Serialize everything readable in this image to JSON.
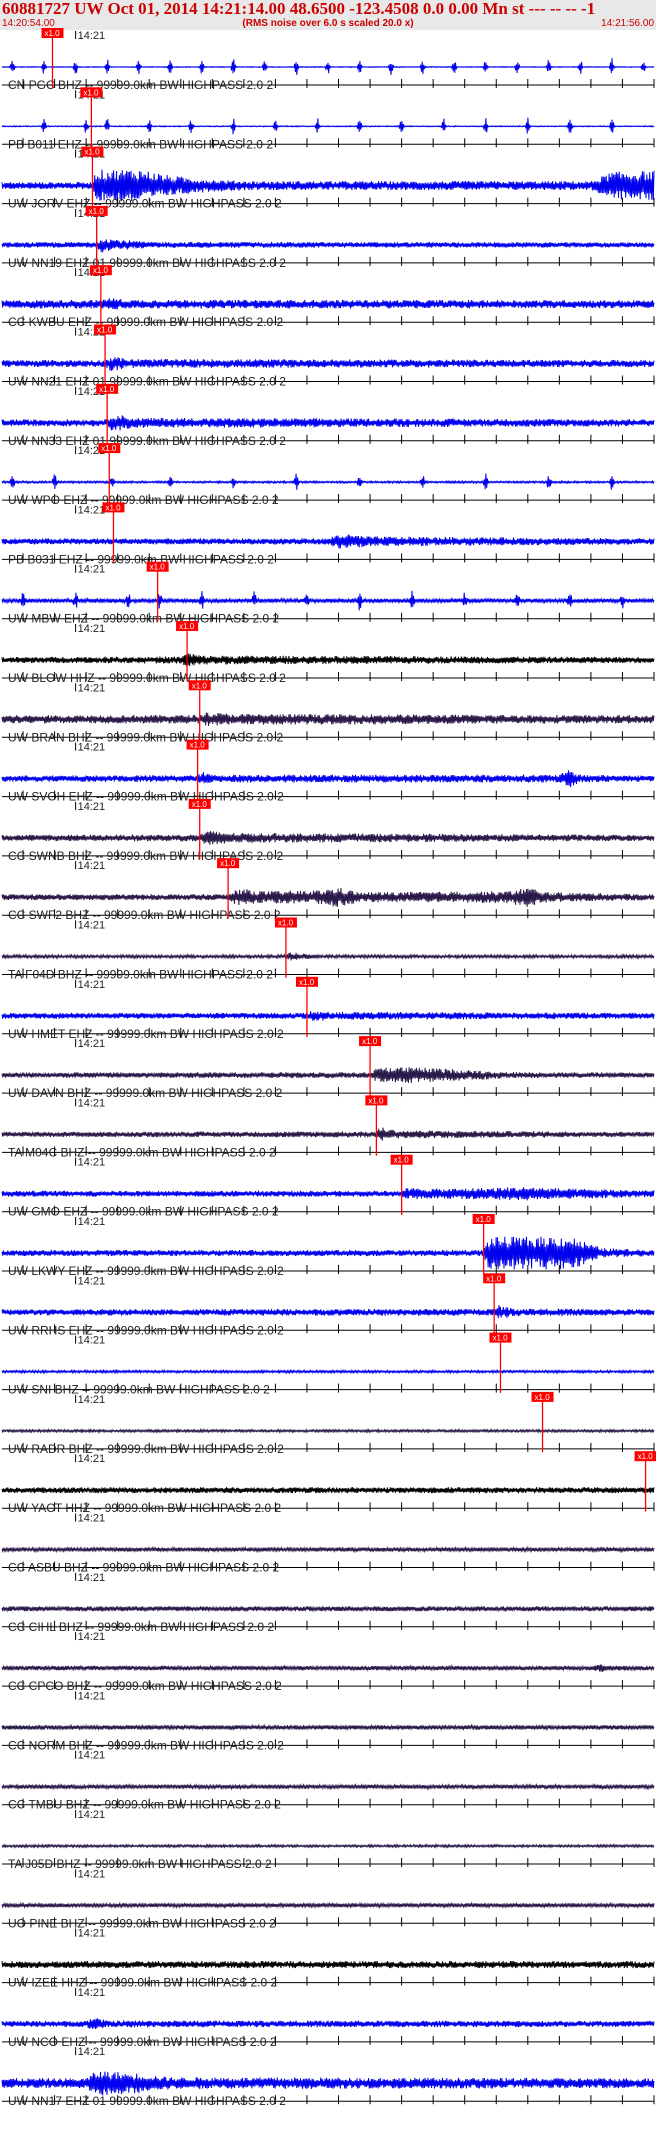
{
  "header": {
    "title": "60881727 UW Oct 01, 2014 14:21:14.00   48.6500 -123.4508  0.0 0.00 Mn st --- -- --   -1",
    "subtitle": "(RMS noise over 6.0 s scaled 20.0 x)",
    "start_time": "14:20:54.00",
    "end_time": "14:21:56.00"
  },
  "colors": {
    "trace_blue": "#0000ee",
    "trace_dark": "#2a1a4a",
    "trace_black": "#000000",
    "pick": "#ff0000",
    "header_bg": "#e8e8e8",
    "header_text": "#cc0000"
  },
  "chart_data": {
    "type": "line",
    "x_range_s": [
      0,
      62
    ],
    "minute_label": "14:21",
    "pick_flag_text": "x1.0",
    "channels": [
      {
        "label": "CN PGC BHZ -- 99999.0km BW  HIGHPASS  2.0  2",
        "color": "blue",
        "pick_s": 4.8,
        "env": [
          [
            0,
            0.04
          ]
        ],
        "spikes": [
          1,
          4,
          7,
          10,
          13,
          16,
          19,
          22,
          25,
          28,
          31,
          34,
          37,
          40,
          43,
          46,
          49,
          52,
          55,
          58,
          61
        ]
      },
      {
        "label": "PB B011 EHZ -- 99999.0km BW  HIGHPASS  2.0  2",
        "color": "blue",
        "pick_s": 8.5,
        "env": [
          [
            0,
            0.05
          ]
        ],
        "spikes": [
          4,
          8,
          10,
          14,
          18,
          22,
          26,
          30,
          34,
          38,
          42,
          46,
          50,
          54,
          58
        ]
      },
      {
        "label": "UW JORV EHZ -- 99999.0km BW  HIGHPASS  2.0  2",
        "color": "blue",
        "pick_s": 8.6,
        "env": [
          [
            0,
            0.35
          ],
          [
            8.5,
            0.35
          ],
          [
            9,
            1.6
          ],
          [
            13,
            1.7
          ],
          [
            16,
            1.0
          ],
          [
            20,
            0.6
          ],
          [
            24,
            0.45
          ],
          [
            56,
            0.45
          ],
          [
            58,
            1.4
          ],
          [
            62,
            1.5
          ]
        ]
      },
      {
        "label": "UW NN19 EHZ 01 99999.0km BW  HIGHPASS  2.0  2",
        "color": "blue",
        "pick_s": 9.0,
        "env": [
          [
            0,
            0.25
          ],
          [
            9,
            0.3
          ],
          [
            9.5,
            0.8
          ],
          [
            11,
            0.55
          ],
          [
            14,
            0.3
          ],
          [
            62,
            0.25
          ]
        ]
      },
      {
        "label": "CC KWBU EHZ -- 99999.0km BW  HIGHPASS  2.0  2",
        "color": "blue",
        "pick_s": 9.4,
        "env": [
          [
            0,
            0.4
          ],
          [
            9.4,
            0.45
          ],
          [
            10,
            0.7
          ],
          [
            12,
            0.45
          ],
          [
            62,
            0.4
          ]
        ]
      },
      {
        "label": "UW NN21 EHZ 01 99999.0km BW  HIGHPASS  2.0  2",
        "color": "blue",
        "pick_s": 9.8,
        "env": [
          [
            0,
            0.35
          ],
          [
            9.8,
            0.35
          ],
          [
            10.4,
            0.8
          ],
          [
            12,
            0.45
          ],
          [
            62,
            0.35
          ]
        ]
      },
      {
        "label": "UW NN33 EHZ 01 99999.0km BW  HIGHPASS  2.0  2",
        "color": "blue",
        "pick_s": 10.0,
        "env": [
          [
            0,
            0.35
          ],
          [
            10,
            0.35
          ],
          [
            10.5,
            1.0
          ],
          [
            12.5,
            0.5
          ],
          [
            62,
            0.35
          ]
        ]
      },
      {
        "label": "UW WPO EHZ -- 99999.0km BW  HIGHPASS  2.0  2",
        "color": "blue",
        "pick_s": 10.2,
        "env": [
          [
            0,
            0.1
          ],
          [
            62,
            0.1
          ]
        ],
        "spikes": [
          1,
          5,
          10.5,
          16,
          22,
          28,
          34,
          40,
          46,
          52,
          58
        ]
      },
      {
        "label": "PB B031 EHZ -- 99999.0km BW  HIGHPASS  2.0  2",
        "color": "blue",
        "pick_s": 10.6,
        "env": [
          [
            0,
            0.3
          ],
          [
            31,
            0.3
          ],
          [
            32,
            0.8
          ],
          [
            35,
            0.5
          ],
          [
            62,
            0.3
          ]
        ]
      },
      {
        "label": "UW MBW EHZ -- 99999.0km BW  HIGHPASS  2.0  2",
        "color": "blue",
        "pick_s": 14.8,
        "env": [
          [
            0,
            0.2
          ],
          [
            62,
            0.2
          ]
        ],
        "spikes": [
          2,
          7,
          12,
          15,
          19,
          24,
          29,
          34,
          39,
          44,
          49,
          54,
          59
        ]
      },
      {
        "label": "UW BLOW HHZ -- 99999.0km BW  HIGHPASS  2.0  2",
        "color": "black",
        "pick_s": 17.6,
        "env": [
          [
            0,
            0.3
          ],
          [
            17,
            0.35
          ],
          [
            17.6,
            0.8
          ],
          [
            19,
            0.45
          ],
          [
            62,
            0.3
          ]
        ]
      },
      {
        "label": "UW BRAN BHZ -- 99999.0km BW  HIGHPASS  2.0  2",
        "color": "dark",
        "pick_s": 18.8,
        "env": [
          [
            0,
            0.4
          ],
          [
            18.8,
            0.45
          ],
          [
            19.5,
            0.75
          ],
          [
            22,
            0.55
          ],
          [
            62,
            0.4
          ]
        ]
      },
      {
        "label": "UW SVOH EHZ -- 99999.0km BW  HIGHPASS  2.0  2",
        "color": "blue",
        "pick_s": 18.6,
        "env": [
          [
            0,
            0.3
          ],
          [
            18.6,
            0.35
          ],
          [
            19,
            0.7
          ],
          [
            20,
            0.4
          ],
          [
            53,
            0.4
          ],
          [
            54,
            0.9
          ],
          [
            55,
            0.4
          ],
          [
            62,
            0.3
          ]
        ]
      },
      {
        "label": "CC SWNB BHZ -- 99999.0km BW  HIGHPASS  2.0  2",
        "color": "dark",
        "pick_s": 18.8,
        "env": [
          [
            0,
            0.3
          ],
          [
            18.8,
            0.35
          ],
          [
            19.5,
            0.75
          ],
          [
            22,
            0.5
          ],
          [
            62,
            0.3
          ]
        ]
      },
      {
        "label": "CC SWF2 BHZ -- 99999.0km BW  HIGHPASS  2.0  2",
        "color": "dark",
        "pick_s": 21.5,
        "env": [
          [
            0,
            0.3
          ],
          [
            21.5,
            0.3
          ],
          [
            22.5,
            0.9
          ],
          [
            25,
            0.6
          ],
          [
            30,
            0.7
          ],
          [
            32,
            1.0
          ],
          [
            34,
            0.5
          ],
          [
            48,
            0.6
          ],
          [
            50,
            1.0
          ],
          [
            52,
            0.5
          ],
          [
            62,
            0.3
          ]
        ]
      },
      {
        "label": "TA F04D BHZ -- 99999.0km BW  HIGHPASS  2.0  2",
        "color": "dark",
        "pick_s": 27.0,
        "env": [
          [
            0,
            0.15
          ],
          [
            27,
            0.15
          ],
          [
            27.5,
            0.5
          ],
          [
            28.5,
            0.3
          ],
          [
            30,
            0.15
          ],
          [
            62,
            0.15
          ]
        ]
      },
      {
        "label": "UW HMET EHZ -- 99999.0km BW  HIGHPASS  2.0  2",
        "color": "blue",
        "pick_s": 29.0,
        "env": [
          [
            0,
            0.3
          ],
          [
            29,
            0.3
          ],
          [
            29.5,
            0.6
          ],
          [
            31,
            0.4
          ],
          [
            62,
            0.3
          ]
        ]
      },
      {
        "label": "UW DAVN BHZ -- 99999.0km BW  HIGHPASS  2.0  2",
        "color": "dark",
        "pick_s": 35.0,
        "env": [
          [
            0,
            0.25
          ],
          [
            35,
            0.3
          ],
          [
            36,
            0.9
          ],
          [
            40,
            0.75
          ],
          [
            45,
            0.5
          ],
          [
            48,
            0.3
          ],
          [
            62,
            0.25
          ]
        ]
      },
      {
        "label": "TA M04C BHZ -- 99999.0km BW  HIGHPASS  2.0  2",
        "color": "dark",
        "pick_s": 35.6,
        "env": [
          [
            0,
            0.25
          ],
          [
            35.6,
            0.3
          ],
          [
            36,
            0.8
          ],
          [
            37.5,
            0.4
          ],
          [
            62,
            0.25
          ]
        ]
      },
      {
        "label": "UW GMO EHZ -- 99999.0km BW  HIGHPASS  2.0  2",
        "color": "blue",
        "pick_s": 38.0,
        "env": [
          [
            0,
            0.3
          ],
          [
            38,
            0.3
          ],
          [
            38.5,
            0.6
          ],
          [
            42,
            0.5
          ],
          [
            46,
            0.6
          ],
          [
            50,
            0.7
          ],
          [
            54,
            0.5
          ],
          [
            62,
            0.35
          ]
        ]
      },
      {
        "label": "UW LKWY EHZ -- 99999.0km BW  HIGHPASS  2.0  2",
        "color": "blue",
        "pick_s": 45.8,
        "env": [
          [
            0,
            0.3
          ],
          [
            45.8,
            0.3
          ],
          [
            46.2,
            1.6
          ],
          [
            54,
            1.7
          ],
          [
            57,
            0.5
          ],
          [
            62,
            0.3
          ]
        ]
      },
      {
        "label": "UW RRHS EHZ -- 99999.0km BW  HIGHPASS  2.0  2",
        "color": "blue",
        "pick_s": 46.8,
        "env": [
          [
            0,
            0.3
          ],
          [
            46.8,
            0.35
          ],
          [
            47.2,
            0.8
          ],
          [
            48.5,
            0.4
          ],
          [
            62,
            0.3
          ]
        ]
      },
      {
        "label": "UW SNI BHZ -- 99999.0km BW  HIGHPASS  2.0  2",
        "color": "blue",
        "pick_s": 47.4,
        "env": [
          [
            0,
            0.12
          ],
          [
            62,
            0.12
          ]
        ]
      },
      {
        "label": "UW RADR BHZ -- 99999.0km BW  HIGHPASS  2.0  2",
        "color": "dark",
        "pick_s": 51.4,
        "env": [
          [
            0,
            0.12
          ],
          [
            62,
            0.12
          ]
        ]
      },
      {
        "label": "UW YACT HHZ -- 99999.0km BW  HIGHPASS  2.0  2",
        "color": "black",
        "pick_s": 61.2,
        "env": [
          [
            0,
            0.3
          ],
          [
            62,
            0.3
          ]
        ]
      },
      {
        "label": "CC ASBU BHZ -- 99999.0km BW  HIGHPASS  2.0  2",
        "color": "dark",
        "env": [
          [
            0,
            0.2
          ],
          [
            62,
            0.2
          ]
        ]
      },
      {
        "label": "CC CIHL BHZ -- 99999.0km BW  HIGHPASS  2.0  2",
        "color": "dark",
        "env": [
          [
            0,
            0.25
          ],
          [
            62,
            0.25
          ]
        ]
      },
      {
        "label": "CC CPCO BHZ -- 99999.0km BW  HIGHPASS  2.0  2",
        "color": "dark",
        "env": [
          [
            0,
            0.22
          ],
          [
            56,
            0.22
          ],
          [
            57,
            0.5
          ],
          [
            58,
            0.25
          ],
          [
            62,
            0.22
          ]
        ]
      },
      {
        "label": "CC NORM BHZ -- 99999.0km BW  HIGHPASS  2.0  2",
        "color": "dark",
        "env": [
          [
            0,
            0.22
          ],
          [
            62,
            0.22
          ]
        ]
      },
      {
        "label": "CC TMBU BHZ -- 99999.0km BW  HIGHPASS  2.0  2",
        "color": "dark",
        "env": [
          [
            0,
            0.2
          ],
          [
            62,
            0.2
          ]
        ]
      },
      {
        "label": "TA J05D BHZ -- 99999.0km BW  HIGHPASS  2.0  2",
        "color": "dark",
        "env": [
          [
            0,
            0.12
          ],
          [
            62,
            0.12
          ]
        ]
      },
      {
        "label": "UO PINE BHZ -- 99999.0km BW  HIGHPASS  2.0  2",
        "color": "dark",
        "env": [
          [
            0,
            0.2
          ],
          [
            62,
            0.2
          ]
        ]
      },
      {
        "label": "UW IZEE HHZ -- 99999.0km BW  HIGHPASS  2.0  2",
        "color": "black",
        "env": [
          [
            0,
            0.35
          ],
          [
            62,
            0.35
          ]
        ]
      },
      {
        "label": "UW NCO EHZ -- 99999.0km BW  HIGHPASS  2.0  2",
        "color": "blue",
        "env": [
          [
            0,
            0.3
          ],
          [
            8,
            0.3
          ],
          [
            8.6,
            0.7
          ],
          [
            10,
            0.35
          ],
          [
            62,
            0.3
          ]
        ]
      },
      {
        "label": "UW NN17 EHZ 01 99999.0km BW  HIGHPASS  2.0  2",
        "color": "blue",
        "env": [
          [
            0,
            0.5
          ],
          [
            8,
            0.5
          ],
          [
            9,
            1.3
          ],
          [
            13,
            1.0
          ],
          [
            16,
            0.6
          ],
          [
            62,
            0.5
          ]
        ]
      }
    ]
  }
}
